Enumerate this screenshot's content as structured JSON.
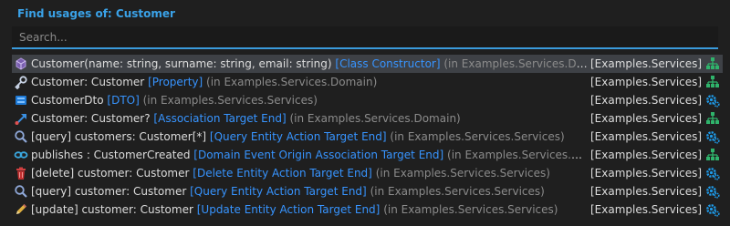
{
  "title": "Find usages of: Customer",
  "search": {
    "placeholder": "Search...",
    "value": ""
  },
  "results": [
    {
      "name": "Customer(name: string, surname: string, email: string)",
      "kind": "[Class Constructor]",
      "location": "(in Examples.Services.Domain)",
      "package": "[Examples.Services]",
      "icon": "class-constructor-icon",
      "side_icon": "domain-diagram-icon"
    },
    {
      "name": "Customer: Customer",
      "kind": "[Property]",
      "location": "(in Examples.Services.Domain)",
      "package": "[Examples.Services]",
      "icon": "property-icon",
      "side_icon": "domain-diagram-icon"
    },
    {
      "name": "CustomerDto",
      "kind": "[DTO]",
      "location": "(in Examples.Services.Services)",
      "package": "[Examples.Services]",
      "icon": "dto-icon",
      "side_icon": "services-gear-icon"
    },
    {
      "name": "Customer: Customer?",
      "kind": "[Association Target End]",
      "location": "(in Examples.Services.Domain)",
      "package": "[Examples.Services]",
      "icon": "association-arrow-icon",
      "side_icon": "domain-diagram-icon"
    },
    {
      "name": "[query] customers: Customer[*]",
      "kind": "[Query Entity Action Target End]",
      "location": "(in Examples.Services.Services)",
      "package": "[Examples.Services]",
      "icon": "query-magnifier-icon",
      "side_icon": "services-gear-icon"
    },
    {
      "name": "publishes : CustomerCreated",
      "kind": "[Domain Event Origin Association Target End]",
      "location": "(in Examples.Services.Dom...",
      "package": "[Examples.Services]",
      "icon": "event-link-icon",
      "side_icon": "domain-diagram-icon"
    },
    {
      "name": "[delete] customer: Customer",
      "kind": "[Delete Entity Action Target End]",
      "location": "(in Examples.Services.Services)",
      "package": "[Examples.Services]",
      "icon": "delete-trash-icon",
      "side_icon": "services-gear-icon"
    },
    {
      "name": "[query] customer: Customer",
      "kind": "[Query Entity Action Target End]",
      "location": "(in Examples.Services.Services)",
      "package": "[Examples.Services]",
      "icon": "query-magnifier-icon",
      "side_icon": "services-gear-icon"
    },
    {
      "name": "[update] customer: Customer",
      "kind": "[Update Entity Action Target End]",
      "location": "(in Examples.Services.Services)",
      "package": "[Examples.Services]",
      "icon": "update-pencil-icon",
      "side_icon": "services-gear-icon"
    }
  ],
  "selected_index": 0
}
